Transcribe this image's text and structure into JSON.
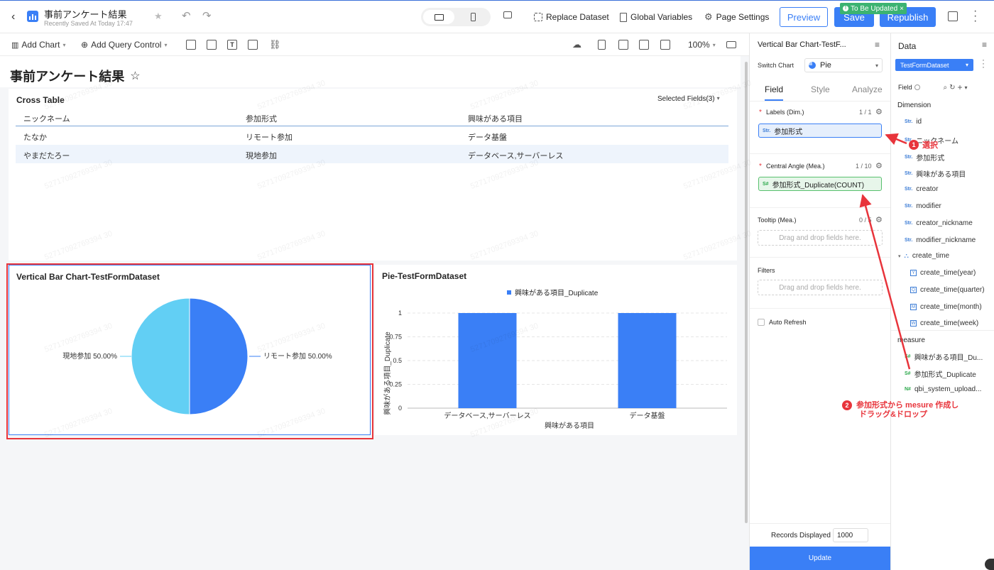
{
  "header": {
    "back_icon": "chevron-left-icon",
    "title": "事前アンケート結果",
    "saved": "Recently Saved At Today 17:47",
    "replace_dataset": "Replace Dataset",
    "global_variables": "Global Variables",
    "page_settings": "Page Settings",
    "preview": "Preview",
    "save": "Save",
    "republish": "Republish",
    "to_be_updated": "To Be Updated"
  },
  "toolbar": {
    "add_chart": "Add Chart",
    "add_query_control": "Add Query Control",
    "zoom": "100%"
  },
  "page": {
    "title": "事前アンケート結果"
  },
  "cross_table": {
    "title": "Cross Table",
    "selected_fields": "Selected Fields(3)",
    "headers": [
      "ニックネーム",
      "参加形式",
      "興味がある項目"
    ],
    "rows": [
      [
        "たなか",
        "リモート参加",
        "データ基盤"
      ],
      [
        "やまだたろー",
        "現地参加",
        "データベース,サーバーレス"
      ]
    ]
  },
  "pie_card": {
    "title": "Vertical Bar Chart-TestFormDataset",
    "label_left": "現地参加 50.00%",
    "label_right": "リモート参加 50.00%"
  },
  "bar_card": {
    "title": "Pie-TestFormDataset",
    "legend": "興味がある項目_Duplicate",
    "xlabel": "興味がある項目",
    "ylabel": "興味がある項目_Duplicate"
  },
  "chart_data": [
    {
      "type": "pie",
      "title": "Vertical Bar Chart-TestFormDataset",
      "categories": [
        "リモート参加",
        "現地参加"
      ],
      "values": [
        50,
        50
      ],
      "colors": [
        "#3a7ff6",
        "#62cff4"
      ]
    },
    {
      "type": "bar",
      "title": "Pie-TestFormDataset",
      "categories": [
        "データベース,サーバーレス",
        "データ基盤"
      ],
      "series": [
        {
          "name": "興味がある項目_Duplicate",
          "values": [
            1,
            1
          ]
        }
      ],
      "yticks": [
        "0",
        "0.25",
        "0.5",
        "0.75",
        "1"
      ],
      "ylim": [
        0,
        1
      ],
      "xlabel": "興味がある項目",
      "ylabel": "興味がある項目_Duplicate",
      "color": "#3a7ff6"
    }
  ],
  "config": {
    "chart_name": "Vertical Bar Chart-TestF...",
    "switch_chart_label": "Switch Chart",
    "switch_chart_value": "Pie",
    "tabs": [
      "Field",
      "Style",
      "Analyze"
    ],
    "labels_title": "Labels (Dim.)",
    "labels_count": "1 / 1",
    "labels_field": "参加形式",
    "angle_title": "Central Angle (Mea.)",
    "angle_count": "1 / 10",
    "angle_field": "参加形式_Duplicate(COUNT)",
    "tooltip_title": "Tooltip (Mea.)",
    "tooltip_count": "0 / 5",
    "drop_hint": "Drag and drop fields here.",
    "filters_title": "Filters",
    "auto_refresh": "Auto Refresh",
    "records_label": "Records Displayed",
    "records_value": "1000",
    "update": "Update"
  },
  "data_panel": {
    "title": "Data",
    "dataset": "TestFormDataset",
    "field_label": "Field",
    "dimension_title": "Dimension",
    "dimensions": [
      "id",
      "ニックネーム",
      "参加形式",
      "興味がある項目",
      "creator",
      "modifier",
      "creator_nickname",
      "modifier_nickname"
    ],
    "create_time": "create_time",
    "create_time_children": [
      {
        "tag": "Y",
        "label": "create_time(year)"
      },
      {
        "tag": "Q",
        "label": "create_time(quarter)"
      },
      {
        "tag": "M",
        "label": "create_time(month)"
      },
      {
        "tag": "W",
        "label": "create_time(week)"
      }
    ],
    "measure_title": "measure",
    "measures": [
      "興味がある項目_Du...",
      "参加形式_Duplicate",
      "qbi_system_upload..."
    ]
  },
  "annotations": {
    "step1_num": "1",
    "step1_text": "選択",
    "step2_num": "2",
    "step2_line1": "参加形式から mesure 作成し",
    "step2_line2": "ドラッグ&ドロップ",
    "color": "#e8343b"
  },
  "watermark": "52717092769394 30"
}
